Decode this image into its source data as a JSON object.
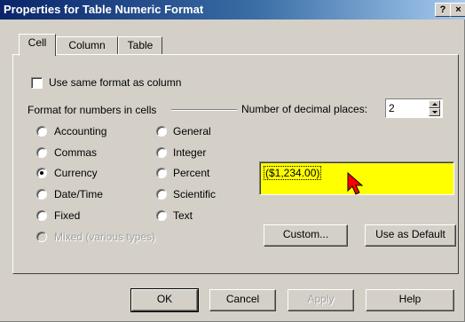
{
  "window": {
    "title": "Properties for Table Numeric Format",
    "help_glyph": "?",
    "close_glyph": "×"
  },
  "tabs": [
    {
      "label": "Cell",
      "active": true
    },
    {
      "label": "Column",
      "active": false
    },
    {
      "label": "Table",
      "active": false
    }
  ],
  "cell": {
    "same_format_label": "Use same format as column",
    "same_format_checked": false,
    "format_group_label": "Format for numbers in cells",
    "decimal_label": "Number of decimal places:",
    "decimal_value": "2",
    "formats": [
      {
        "label": "Accounting",
        "checked": false,
        "disabled": false
      },
      {
        "label": "Commas",
        "checked": false,
        "disabled": false
      },
      {
        "label": "Currency",
        "checked": true,
        "disabled": false
      },
      {
        "label": "Date/Time",
        "checked": false,
        "disabled": false
      },
      {
        "label": "Fixed",
        "checked": false,
        "disabled": false
      },
      {
        "label": "Mixed  (various types)",
        "checked": false,
        "disabled": true
      },
      {
        "label": "General",
        "checked": false,
        "disabled": false
      },
      {
        "label": "Integer",
        "checked": false,
        "disabled": false
      },
      {
        "label": "Percent",
        "checked": false,
        "disabled": false
      },
      {
        "label": "Scientific",
        "checked": false,
        "disabled": false
      },
      {
        "label": "Text",
        "checked": false,
        "disabled": false
      }
    ],
    "preview_value": "($1,234.00)",
    "preview_color": "#ffff00",
    "custom_button": "Custom...",
    "use_default_button": "Use as Default"
  },
  "footer": {
    "ok": "OK",
    "cancel": "Cancel",
    "apply": "Apply",
    "apply_disabled": true,
    "help": "Help"
  },
  "colors": {
    "title_bar_start": "#0a246a",
    "title_bar_end": "#a6caf0",
    "dialog_face": "#d4d0c8",
    "cursor": "#ff0000"
  },
  "icons": {
    "cursor": "pointer-arrow-icon"
  }
}
